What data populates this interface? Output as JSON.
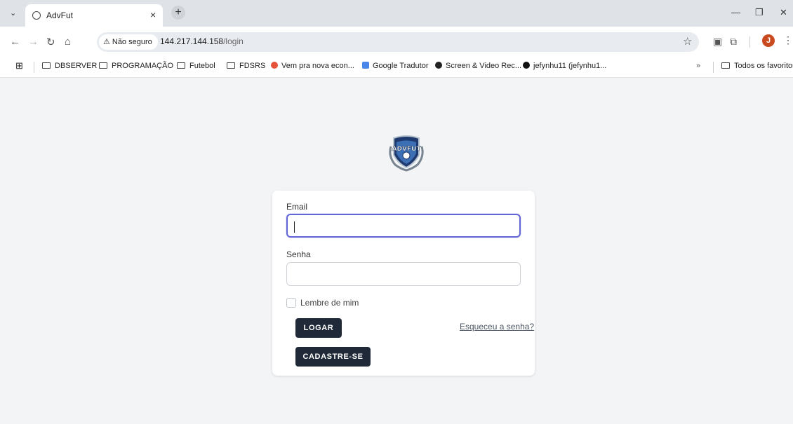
{
  "browser": {
    "tab_title": "AdvFut",
    "security_label": "Não seguro",
    "url_host": "144.217.144.158",
    "url_path": "/login",
    "profile_initial": "J"
  },
  "bookmarks": [
    {
      "label": "DBSERVER",
      "icon": "folder-icon"
    },
    {
      "label": "PROGRAMAÇÃO",
      "icon": "folder-icon"
    },
    {
      "label": "Futebol",
      "icon": "folder-icon"
    },
    {
      "label": "FDSRS",
      "icon": "folder-icon"
    },
    {
      "label": "Vem pra nova econ...",
      "icon": "mb-logo-icon"
    },
    {
      "label": "Google Tradutor",
      "icon": "google-translate-icon"
    },
    {
      "label": "Screen & Video Rec...",
      "icon": "record-icon"
    },
    {
      "label": "jefynhu11 (jefynhu1...",
      "icon": "github-icon"
    },
    {
      "label": "Todos os favoritos",
      "icon": "folder-icon"
    }
  ],
  "login": {
    "logo_text": "ADVFUT",
    "email_label": "Email",
    "email_value": "",
    "password_label": "Senha",
    "password_value": "",
    "remember_label": "Lembre de mim",
    "login_button": "LOGAR",
    "forgot_link": "Esqueceu a senha?",
    "signup_button": "CADASTRE-SE"
  },
  "colors": {
    "primary_button": "#1f2937",
    "focus_ring": "#6366d6",
    "page_bg": "#f3f4f6",
    "insecure_warning": "#222222"
  }
}
